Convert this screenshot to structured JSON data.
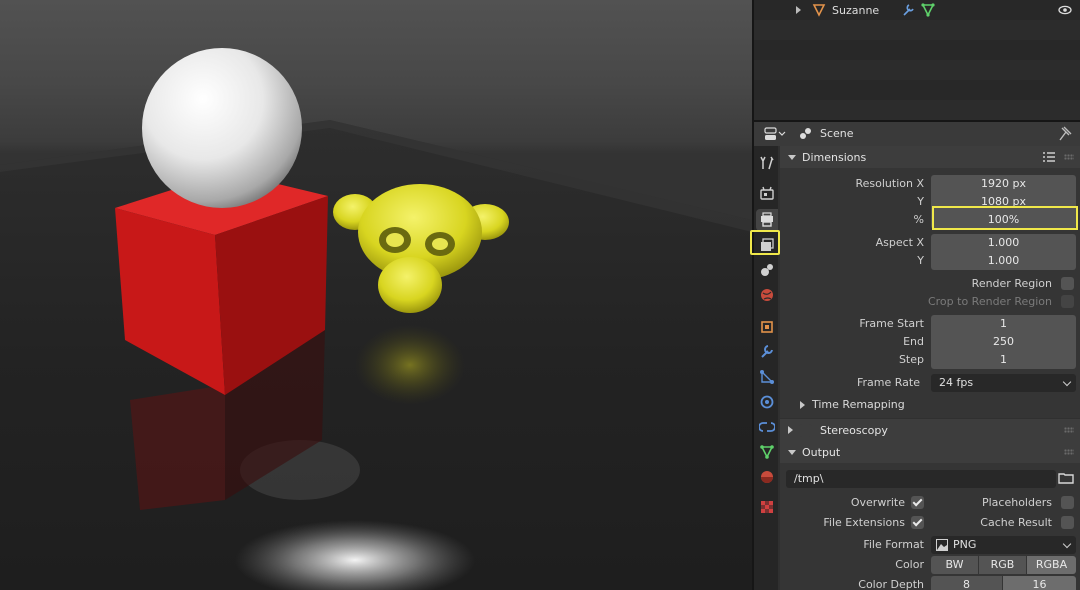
{
  "colors": {
    "highlight": "#f0e84a",
    "field": "#545454",
    "panel_header": "#3d3d3d"
  },
  "outliner": {
    "item": {
      "name": "Suzanne",
      "icon": "mesh-icon",
      "modifier_icon": "wrench-icon",
      "data_icon": "vertex-data-icon",
      "visibility_icon": "eye-icon"
    }
  },
  "properties": {
    "editor_type_icon": "properties-editor-icon",
    "context": "Scene",
    "tabs": [
      "tool",
      "render",
      "output",
      "view-layer",
      "scene",
      "world",
      "object",
      "modifiers",
      "particles",
      "physics",
      "constraints",
      "data",
      "material",
      "texture"
    ],
    "active_tab": "output",
    "dimensions": {
      "title": "Dimensions",
      "resolution_x_label": "Resolution X",
      "resolution_x": "1920 px",
      "resolution_y_label": "Y",
      "resolution_y": "1080 px",
      "percent_label": "%",
      "percent": "100%",
      "aspect_x_label": "Aspect X",
      "aspect_x": "1.000",
      "aspect_y_label": "Y",
      "aspect_y": "1.000",
      "render_region": "Render Region",
      "crop_region": "Crop to Render Region",
      "frame_start_label": "Frame Start",
      "frame_start": "1",
      "frame_end_label": "End",
      "frame_end": "250",
      "frame_step_label": "Step",
      "frame_step": "1",
      "frame_rate_label": "Frame Rate",
      "frame_rate": "24 fps",
      "time_remapping": "Time Remapping"
    },
    "stereoscopy": {
      "title": "Stereoscopy"
    },
    "output": {
      "title": "Output",
      "path": "/tmp\\",
      "overwrite_label": "Overwrite",
      "placeholders_label": "Placeholders",
      "file_extensions_label": "File Extensions",
      "cache_result_label": "Cache Result",
      "file_format_label": "File Format",
      "file_format": "PNG",
      "color_label": "Color",
      "color_options": [
        "BW",
        "RGB",
        "RGBA"
      ],
      "color_selected": "RGBA",
      "color_depth_label": "Color Depth",
      "color_depth_options": [
        "8",
        "16"
      ],
      "color_depth_selected": "16"
    }
  }
}
